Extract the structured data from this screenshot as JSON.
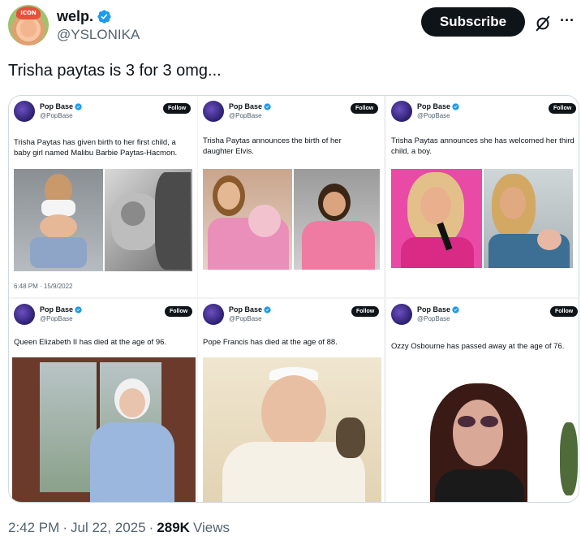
{
  "author": {
    "display_name": "welp.",
    "handle": "@YSLONIKA",
    "avatar_hat_text": "ICON"
  },
  "header": {
    "subscribe_label": "Subscribe",
    "more_icon": "more-icon",
    "grok_icon": "grok-icon"
  },
  "tweet": {
    "text": "Trisha paytas is 3 for 3 omg...",
    "time": "2:42 PM",
    "sep1": "·",
    "date": "Jul 22, 2025",
    "sep2": "·",
    "views_count": "289K",
    "views_label": "Views"
  },
  "media": {
    "panels": [
      {
        "account": "Pop Base",
        "handle": "@PopBase",
        "follow": "Follow",
        "text": "Trisha Paytas has given birth to her first child, a baby girl named Malibu Barbie Paytas-Hacmon.",
        "timestamp": "6:48 PM · 15/9/2022"
      },
      {
        "account": "Pop Base",
        "handle": "@PopBase",
        "follow": "Follow",
        "text": "Trisha Paytas announces the birth of her daughter Elvis."
      },
      {
        "account": "Pop Base",
        "handle": "@PopBase",
        "follow": "Follow",
        "text": "Trisha Paytas announces she has welcomed her third child, a boy."
      },
      {
        "account": "Pop Base",
        "handle": "@PopBase",
        "follow": "Follow",
        "text": "Queen Elizabeth II has died at the age of 96."
      },
      {
        "account": "Pop Base",
        "handle": "@PopBase",
        "follow": "Follow",
        "text": "Pope Francis has died at the age of 88."
      },
      {
        "account": "Pop Base",
        "handle": "@PopBase",
        "follow": "Follow",
        "text": "Ozzy Osbourne has passed away at the age  of 76."
      }
    ]
  },
  "colors": {
    "text_primary": "#0f1419",
    "text_secondary": "#536471",
    "verified_blue": "#1d9bf0",
    "button_dark": "#0f1419",
    "border": "#cfd9de"
  }
}
